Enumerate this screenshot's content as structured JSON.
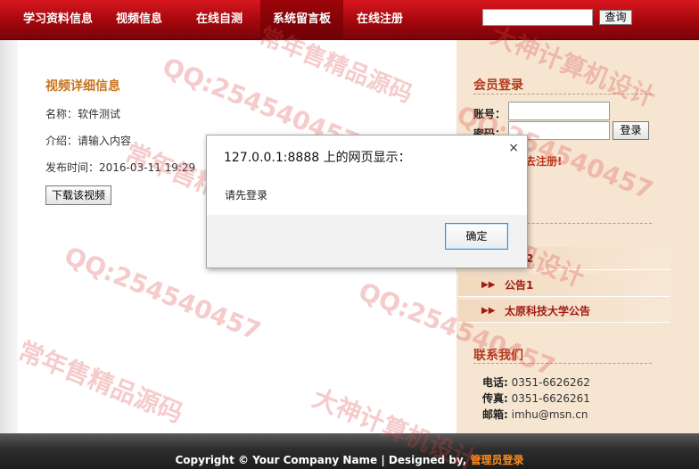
{
  "nav": {
    "items": [
      "学习资料信息",
      "视频信息",
      "在线自测",
      "系统留言板",
      "在线注册"
    ],
    "search_button": "查询"
  },
  "video_detail": {
    "title": "视频详细信息",
    "name_label": "名称：",
    "name_value": "软件测试",
    "intro_label": "介绍：",
    "intro_value": "请输入内容",
    "time_label": "发布时间：",
    "time_value": "2016-03-11 19:29",
    "download_button": "下载该视频"
  },
  "member_login": {
    "title": "会员登录",
    "account_label": "账号：",
    "password_label": "密码：",
    "login_button": "登录",
    "register_link": "去注册!"
  },
  "notices": {
    "items": [
      "公告2",
      "公告1",
      "太原科技大学公告"
    ]
  },
  "contact": {
    "title": "联系我们",
    "phone_label": "电话:",
    "phone_value": " 0351-6626262",
    "fax_label": "传真:",
    "fax_value": " 0351-6626261",
    "email_label": "邮箱:",
    "email_value": " imhu@msn.cn"
  },
  "footer": {
    "copyright": "Copyright © Your Company Name | Designed by, ",
    "admin_link": "管理员登录"
  },
  "dialog": {
    "title": "127.0.0.1:8888 上的网页显示：",
    "close_symbol": "×",
    "message": "请先登录",
    "ok_button": "确定"
  },
  "watermarks": [
    "QQ:254540457",
    "常年售精品源码",
    "大神计算机设计"
  ],
  "colors": {
    "nav_red": "#a3070c",
    "section_title": "#c9731a",
    "sidebar_bg": "#f6e6d1",
    "notice_text": "#9f1a10",
    "footer_link": "#ff8c1a",
    "dialog_focus": "#3d8fd6"
  }
}
